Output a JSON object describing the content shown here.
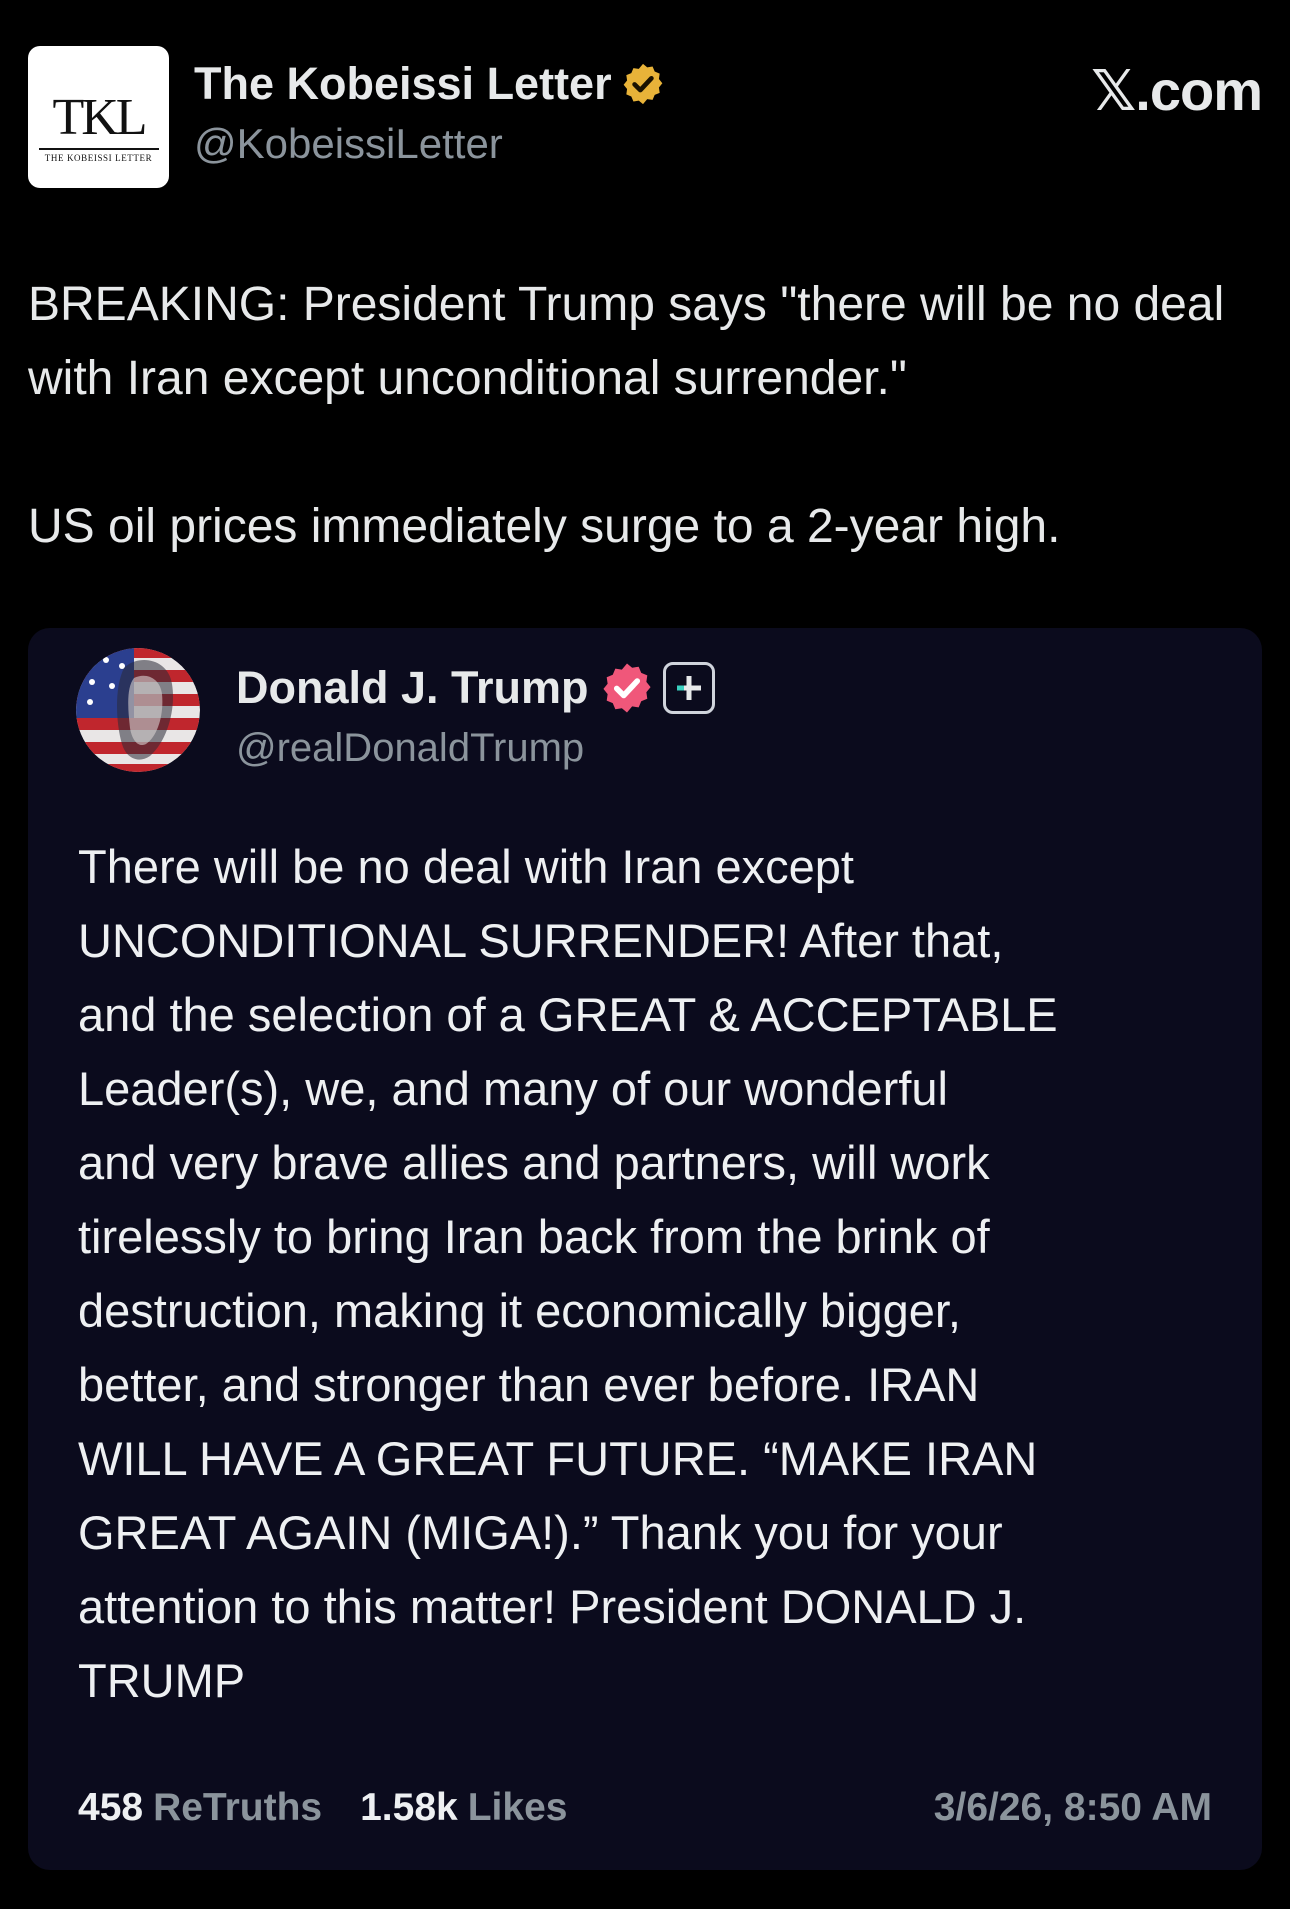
{
  "header": {
    "avatar_logo": {
      "mark": "TKL",
      "subtitle": "THE KOBEISSI LETTER"
    },
    "author_name": "The Kobeissi Letter",
    "author_handle": "@KobeissiLetter",
    "source_label": "𝕏.com",
    "verified_badge_color": "#e8b339"
  },
  "post": {
    "paragraphs": [
      "BREAKING: President Trump says \"there will be no deal with Iran except unconditional surrender.\"",
      "US oil prices immediately surge to a 2-year high."
    ]
  },
  "quoted_post": {
    "author_name": "Donald J. Trump",
    "author_handle": "@realDonaldTrump",
    "verified_badge_color": "#f0577a",
    "body": "There will be no deal with Iran except\nUNCONDITIONAL SURRENDER! After that,\nand the selection of a GREAT & ACCEPTABLE\nLeader(s), we, and many of our wonderful\nand very brave allies and partners, will work\ntirelessly to bring Iran back from the brink of\ndestruction, making it economically bigger,\nbetter, and stronger than ever before. IRAN\nWILL HAVE A GREAT FUTURE. “MAKE IRAN\nGREAT AGAIN (MIGA!).” Thank you for your\nattention to this matter! President DONALD J.\nTRUMP",
    "stats": {
      "retruths_count": "458",
      "retruths_label": "ReTruths",
      "likes_count": "1.58k",
      "likes_label": "Likes"
    },
    "timestamp": "3/6/26, 8:50 AM"
  },
  "colors": {
    "page_background": "#000000",
    "card_background": "#0b0b1d",
    "primary_text": "#e7e9ea",
    "secondary_text": "#8b949c"
  }
}
